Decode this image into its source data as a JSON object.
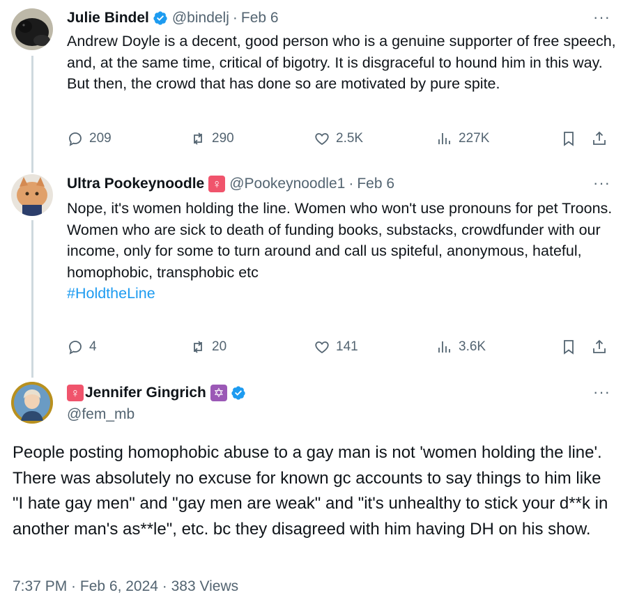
{
  "tweets": [
    {
      "name": "Julie Bindel",
      "handle": "@bindelj",
      "date": "Feb 6",
      "separator": "·",
      "more": "···",
      "text": "Andrew Doyle is a decent, good person who is a genuine supporter of free speech, and, at the same time, critical of bigotry. It is disgraceful to hound him in this way. But then, the crowd that has done so are motivated by pure spite.",
      "replies": "209",
      "reposts": "290",
      "likes": "2.5K",
      "views": "227K"
    },
    {
      "name": "Ultra Pookeynoodle",
      "name_emoji": "♀",
      "handle": "@Pookeynoodle1",
      "date": "Feb 6",
      "separator": "·",
      "more": "···",
      "text_line1": "Nope, it's women holding the line. Women who won't use pronouns for pet Troons.",
      "text_line2": "Women who are sick to death of funding books, substacks, crowdfunder with our income, only for some to turn around and call us spiteful, anonymous, hateful, homophobic, transphobic etc",
      "hashtag": "#HoldtheLine",
      "replies": "4",
      "reposts": "20",
      "likes": "141",
      "views": "3.6K"
    }
  ],
  "main_tweet": {
    "name_prefix_emoji": "♀",
    "name": "Jennifer Gingrich",
    "name_emoji": "✡",
    "handle": "@fem_mb",
    "more": "···",
    "text": "People posting homophobic abuse to a gay man is not 'women holding the line'.  There was absolutely no excuse for known gc accounts to say things to him like \"I hate gay men\" and \"gay men are weak\" and \"it's unhealthy to stick your d**k in another man's as**le\", etc. bc they disagreed with him having DH on his show.",
    "meta": "7:37 PM · Feb 6, 2024 · 383 Views"
  },
  "colors": {
    "text": "#0f1419",
    "secondary": "#536471",
    "link": "#1d9bf0",
    "thread_line": "#cfd9de",
    "verified": "#1d9bf0"
  },
  "icons": [
    "reply-icon",
    "repost-icon",
    "like-icon",
    "views-icon",
    "bookmark-icon",
    "share-icon",
    "verified-badge-icon"
  ]
}
